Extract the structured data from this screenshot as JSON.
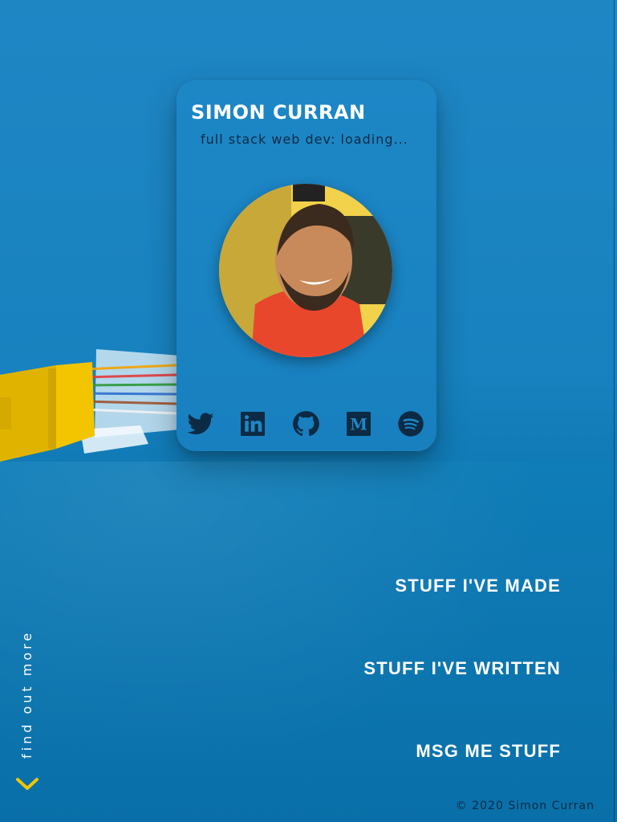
{
  "profile": {
    "name": "SIMON CURRAN",
    "tagline": "full stack web dev: loading..."
  },
  "social": [
    {
      "id": "twitter",
      "icon": "twitter-icon"
    },
    {
      "id": "linkedin",
      "icon": "linkedin-icon"
    },
    {
      "id": "github",
      "icon": "github-icon"
    },
    {
      "id": "medium",
      "icon": "medium-icon"
    },
    {
      "id": "spotify",
      "icon": "spotify-icon"
    }
  ],
  "nav": {
    "made": "STUFF I'VE MADE",
    "written": "STUFF I'VE WRITTEN",
    "msg": "MSG ME STUFF"
  },
  "scroll_hint": "find out more",
  "footer": "© 2020 Simon Curran",
  "colors": {
    "background": "#1782bf",
    "card": "#1d87c6",
    "icon_dark": "#0d2a44",
    "accent_yellow": "#f2c500",
    "text": "#ffffff"
  }
}
